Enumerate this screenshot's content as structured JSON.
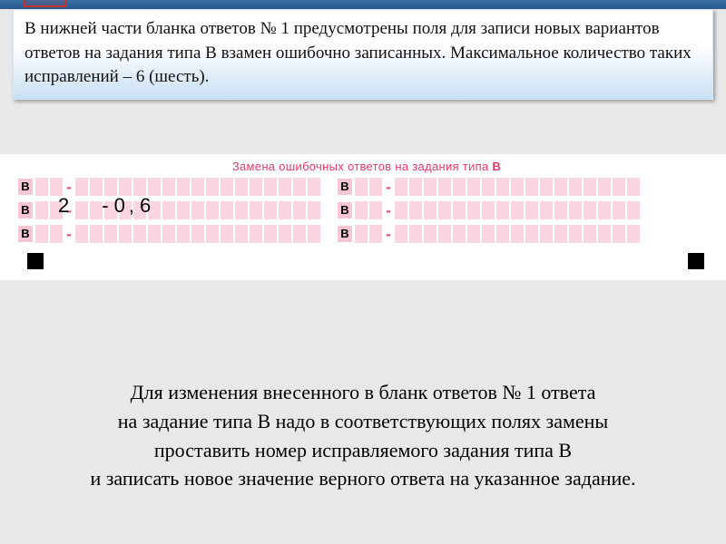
{
  "infobox": {
    "text": "В нижней части бланка ответов № 1 предусмотрены поля для записи новых вариантов ответов на задания типа В взамен ошибочно записанных. Максимальное количество таких исправлений – 6 (шесть)."
  },
  "form": {
    "header_prefix": "Замена ошибочных ответов на задания типа",
    "header_suffix": "В",
    "label": "В",
    "dash": "-",
    "example": {
      "task": "2",
      "dash": "-",
      "v1": "0",
      "comma": ",",
      "v2": "6"
    }
  },
  "body": {
    "line1": "Для изменения внесенного в бланк ответов № 1 ответа",
    "line2": "на задание типа В надо в соответствующих полях замены",
    "line3": "проставить номер исправляемого задания типа В",
    "line4": "и записать новое значение верного ответа на указанное задание."
  }
}
